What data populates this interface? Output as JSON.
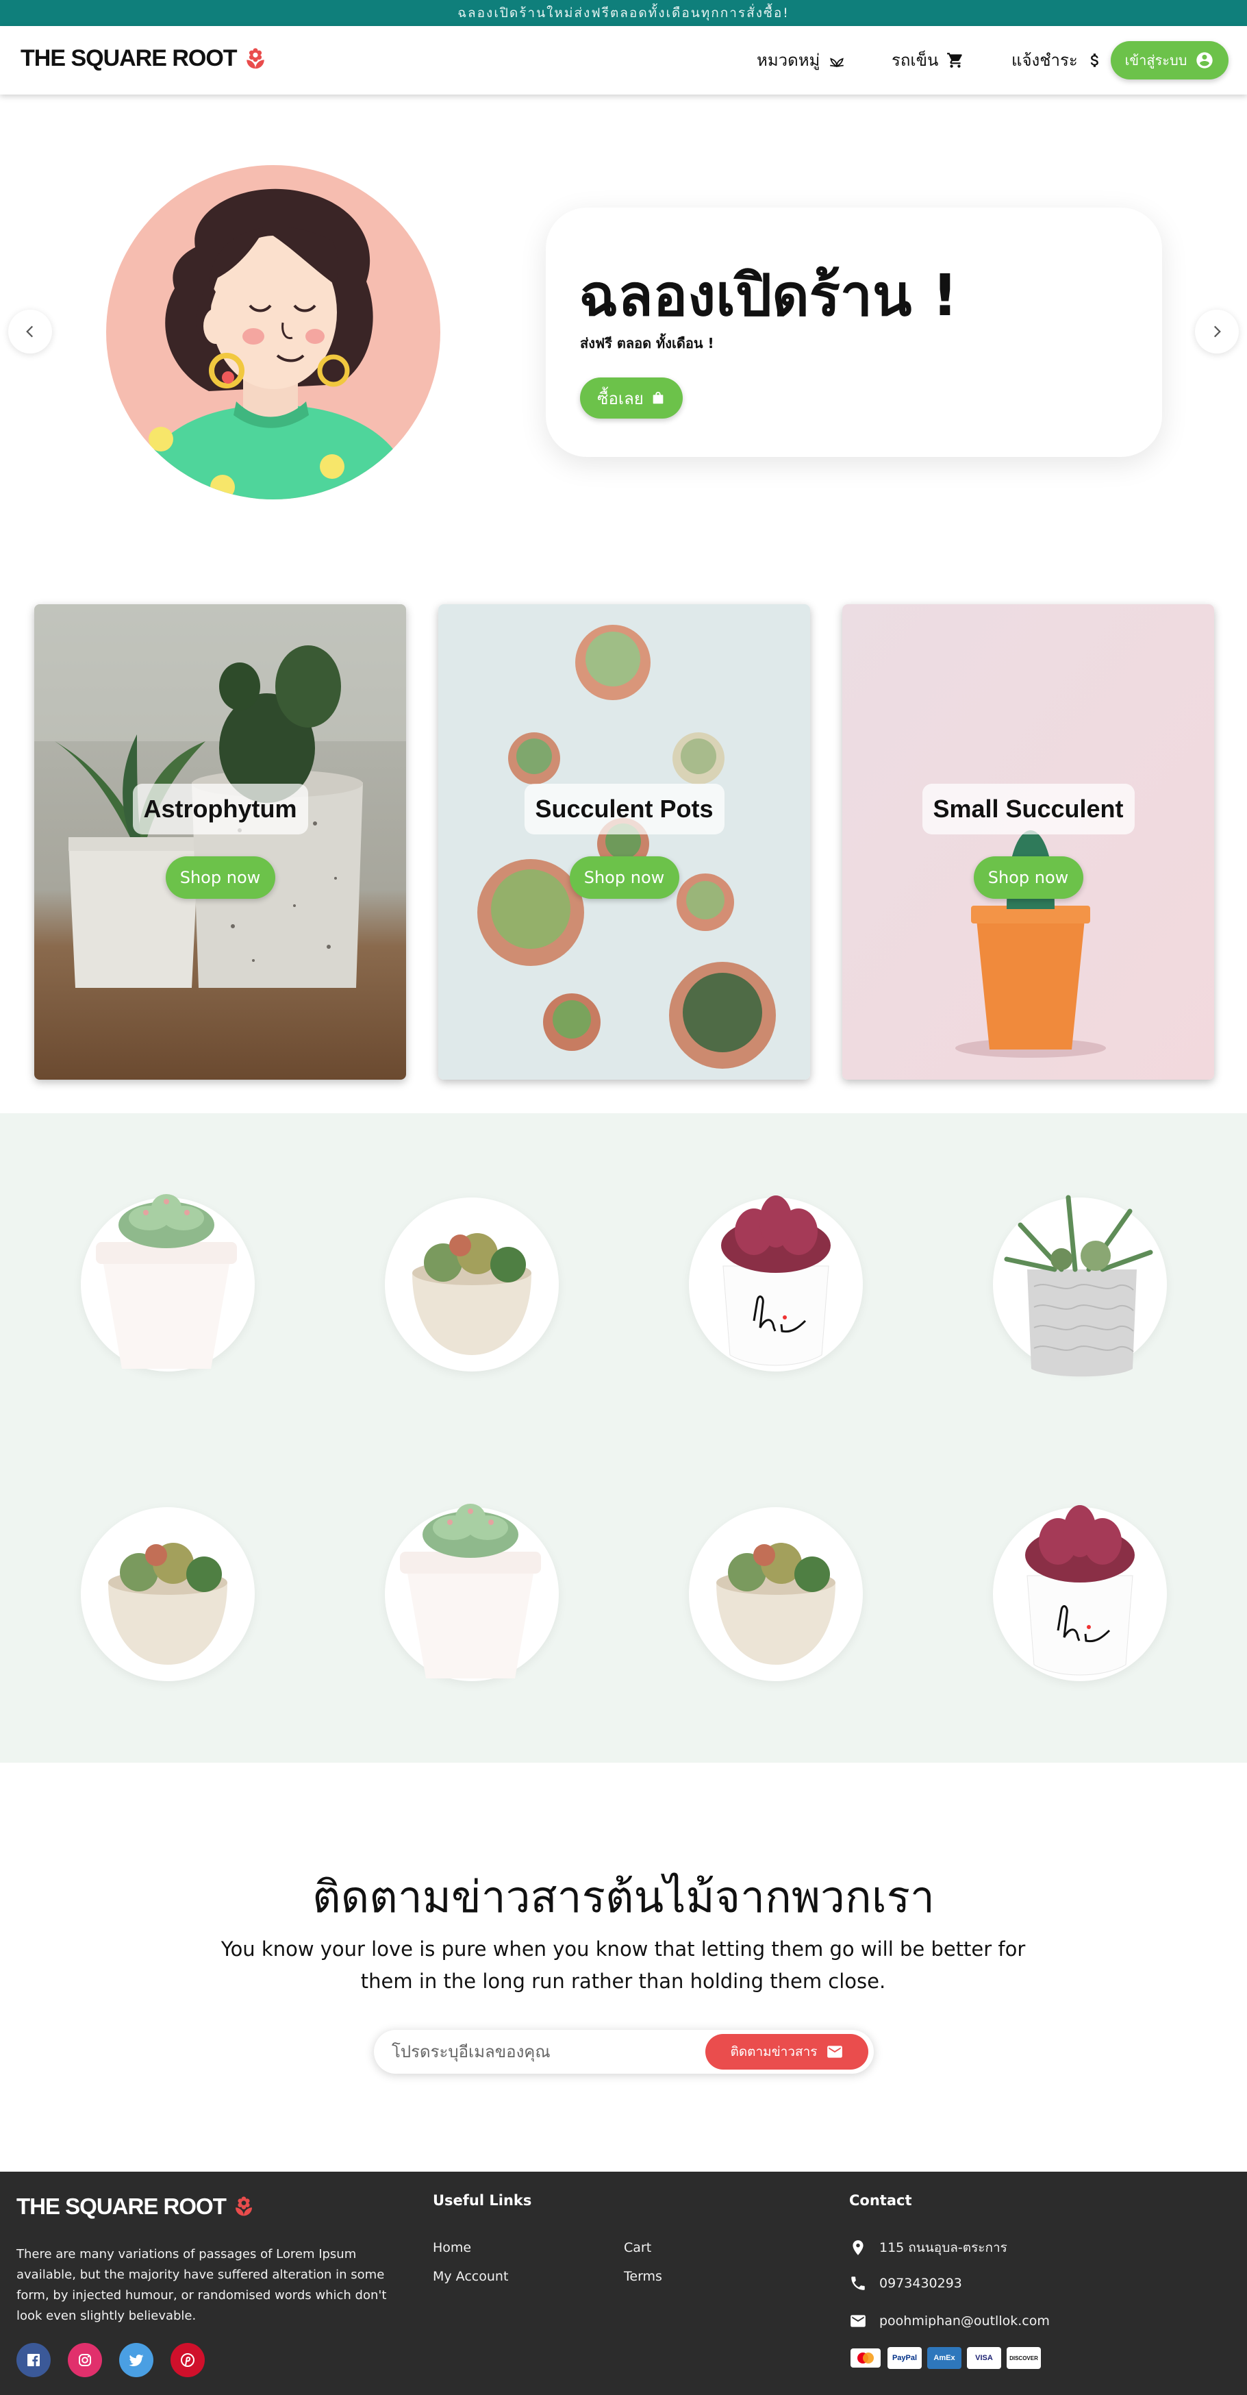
{
  "topbar": {
    "text": "ฉลองเปิดร้านใหม่ส่งฟรีตลอดทั้งเดือนทุกการสั่งซื้อ!"
  },
  "header": {
    "brand": "THE SQUARE ROOT",
    "nav": [
      {
        "label": "หมวดหมู่",
        "icon": "sprout-icon"
      },
      {
        "label": "รถเข็น",
        "icon": "cart-icon"
      },
      {
        "label": "แจ้งชำระ",
        "icon": "dollar-icon"
      }
    ],
    "login_label": "เข้าสู่ระบบ"
  },
  "hero": {
    "title": "ฉลองเปิดร้าน !",
    "subtitle": "ส่งฟรี ตลอด ทั้งเดือน !",
    "button_label": "ซื้อเลย"
  },
  "categories": [
    {
      "name": "Astrophytum",
      "button": "Shop now"
    },
    {
      "name": "Succulent Pots",
      "button": "Shop now"
    },
    {
      "name": "Small Succulent",
      "button": "Shop now"
    }
  ],
  "products": [
    "echeveria-white-pot",
    "mixed-succulent-bowl",
    "red-echeveria-hi-pot",
    "aloe-mix-textured-pot",
    "mixed-succulent-bowl",
    "echeveria-white-pot",
    "mixed-succulent-bowl",
    "red-echeveria-hi-pot"
  ],
  "newsletter": {
    "title": "ติดตามข่าวสารต้นไม้จากพวกเรา",
    "text": "You know your love is pure when you know that letting them go will be better for them in the long run rather than holding them close.",
    "placeholder": "โปรดระบุอีเมลของคุณ",
    "button_label": "ติดตามข่าวสาร"
  },
  "footer": {
    "brand": "THE SQUARE ROOT",
    "about": "There are many variations of passages of Lorem Ipsum available, but the majority have suffered alteration in some form, by injected humour, or randomised words which don't look even slightly believable.",
    "useful_links_heading": "Useful Links",
    "links": [
      "Home",
      "Cart",
      "My Account",
      "Terms"
    ],
    "contact_heading": "Contact",
    "address": "115 ถนนอุบล-ตระการ",
    "phone": "0973430293",
    "email": "poohmiphan@outllok.com",
    "social": [
      "facebook-icon",
      "instagram-icon",
      "twitter-icon",
      "pinterest-icon"
    ],
    "payments": [
      "Mastercard",
      "PayPal",
      "AmEx",
      "VISA",
      "DISCOVER"
    ]
  },
  "colors": {
    "teal": "#0f7f7b",
    "green": "#6cc24a",
    "red": "#ea4d4d",
    "footer": "#2c2c2c",
    "section": "#eff5f1"
  }
}
